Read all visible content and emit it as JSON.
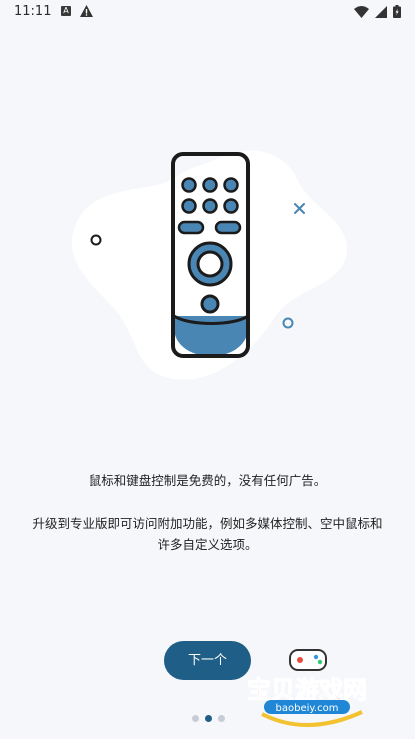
{
  "status_bar": {
    "time": "11:11",
    "a_badge": "A"
  },
  "onboarding": {
    "line1": "鼠标和键盘控制是免费的，没有任何广告。",
    "line2": "升级到专业版即可访问附加功能，例如多媒体控制、空中鼠标和许多自定义选项。",
    "next_label": "下一个",
    "page_count": 3,
    "current_page": 2
  },
  "watermark": {
    "title": "宝贝游戏网",
    "url": "baobeiy.com"
  },
  "colors": {
    "accent": "#1f5e86",
    "remote_blue": "#4a86b4",
    "background": "#f6f7fb"
  }
}
